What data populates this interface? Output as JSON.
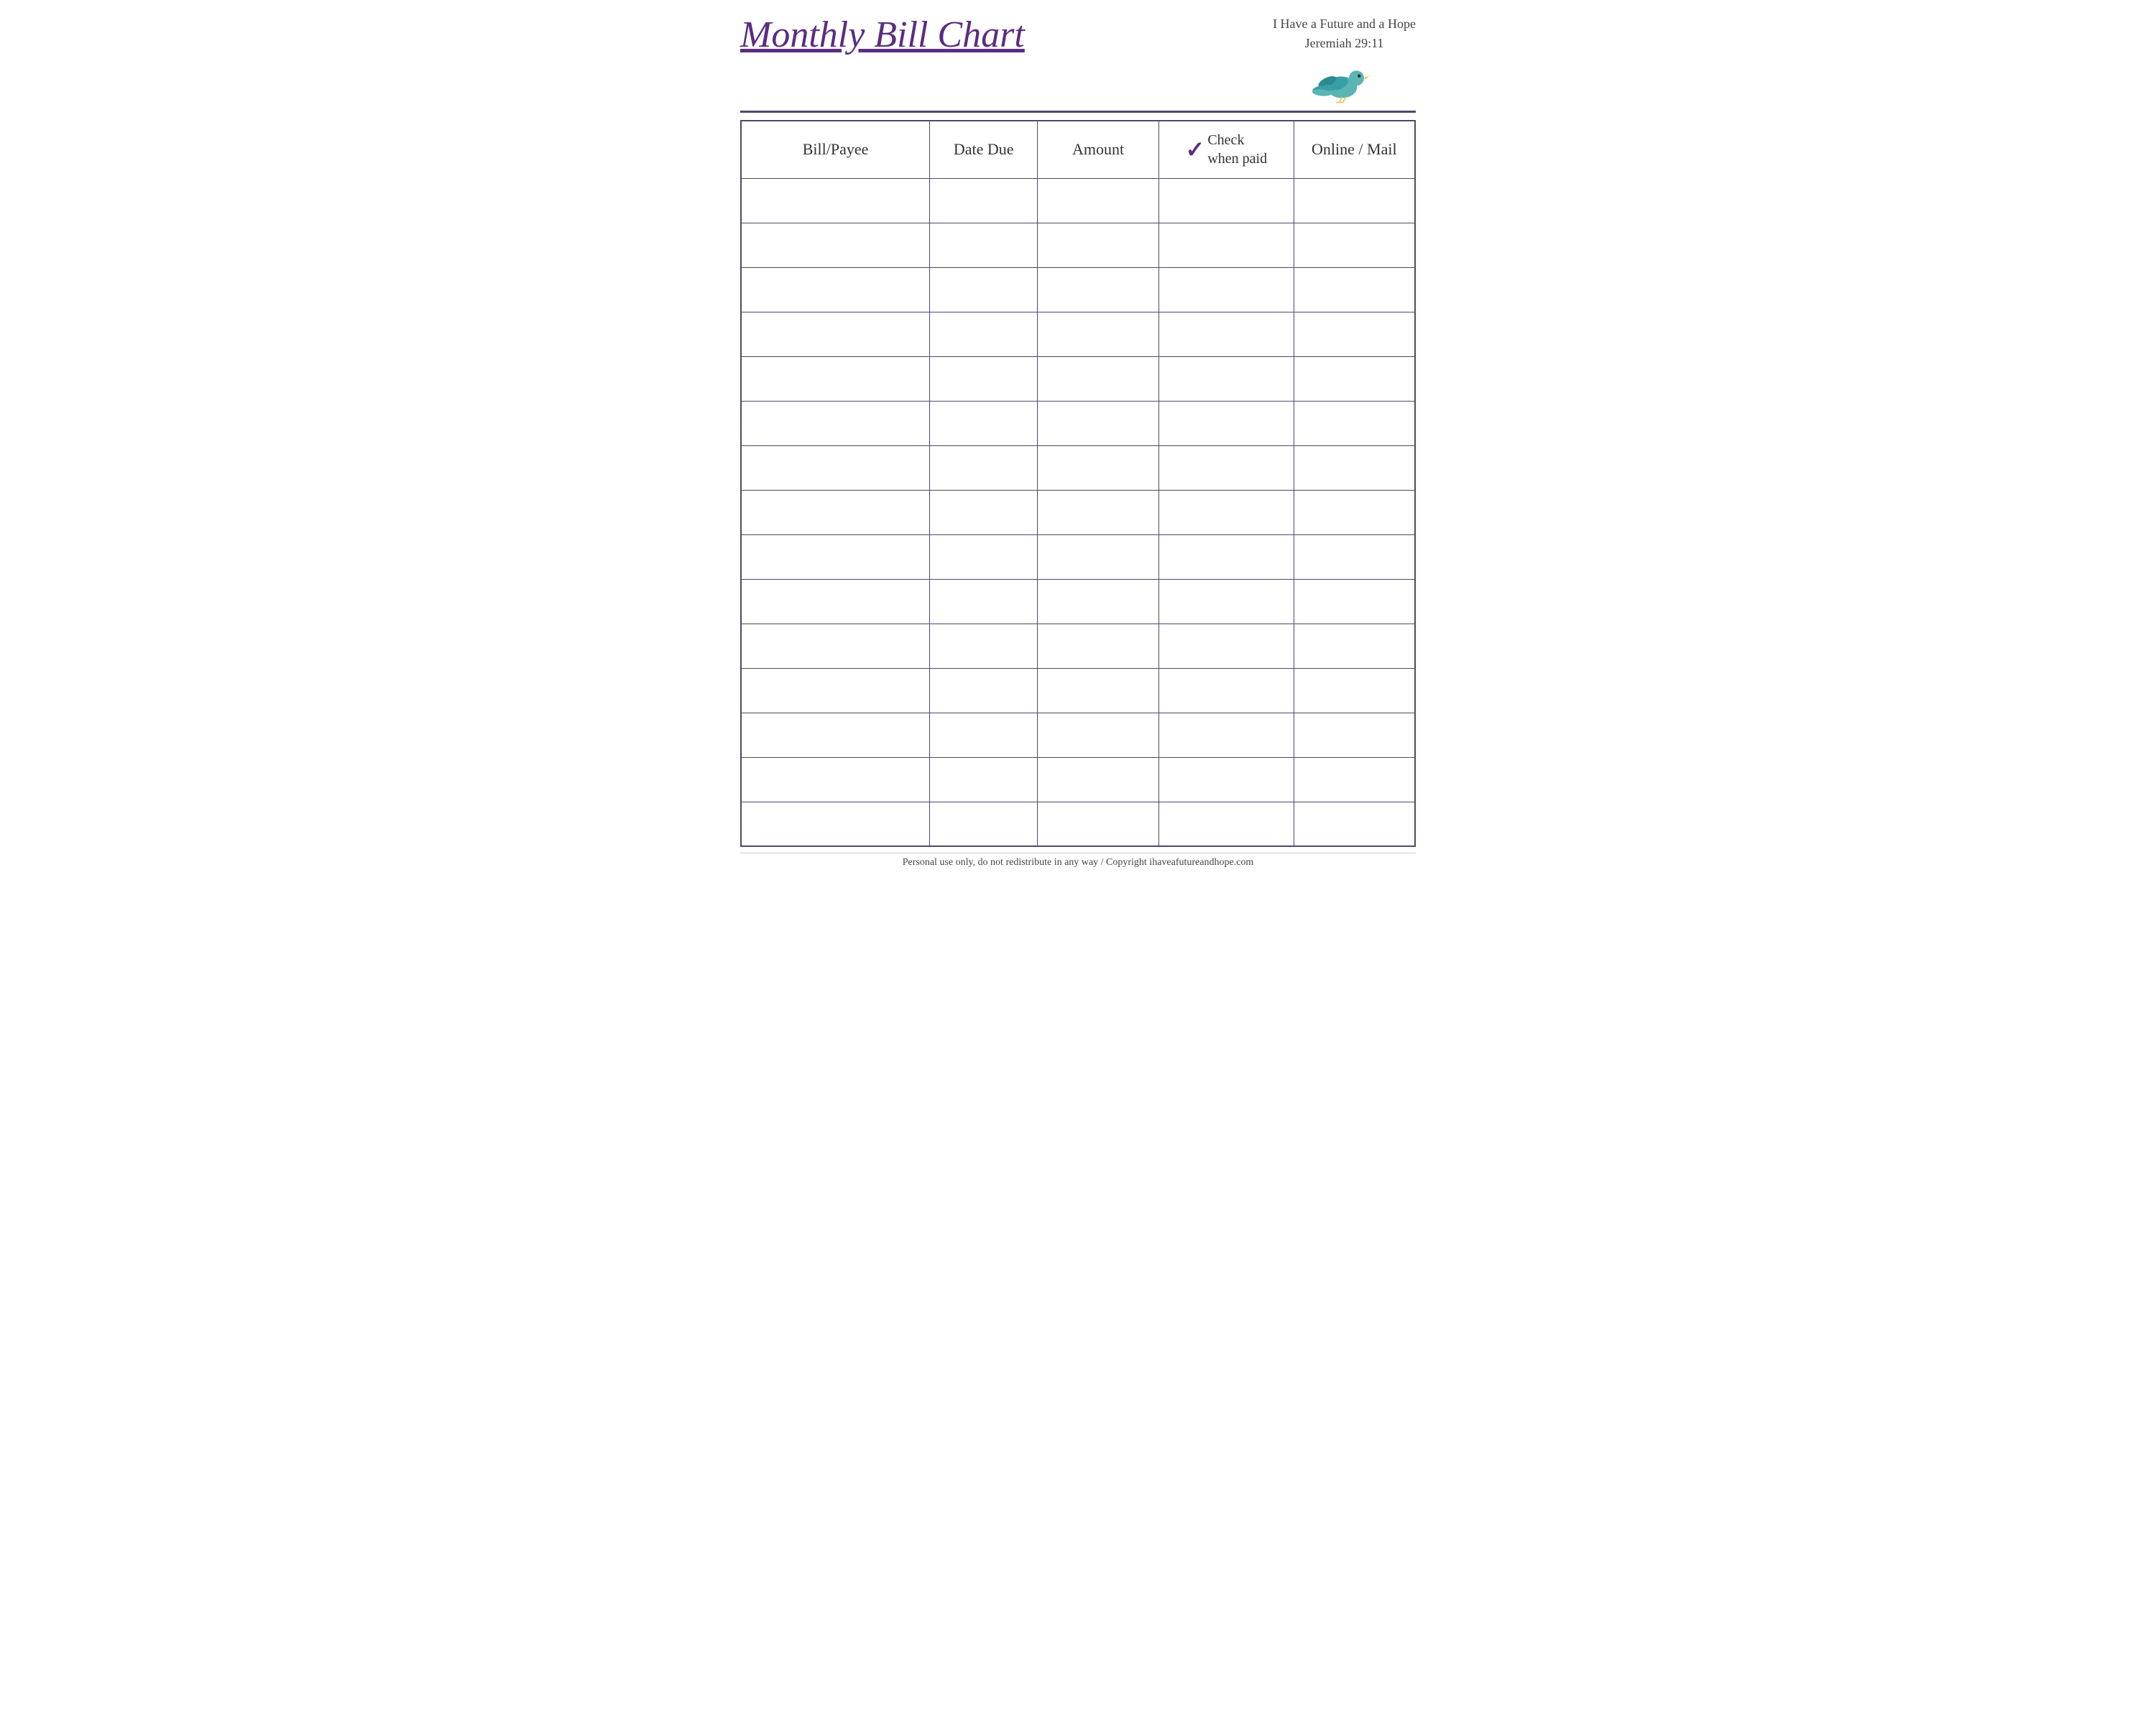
{
  "header": {
    "title": "Monthly Bill Chart",
    "tagline_line1": "I Have a Future and a Hope",
    "tagline_line2": "Jeremiah 29:11"
  },
  "table": {
    "columns": [
      {
        "key": "bill_payee",
        "label": "Bill/Payee"
      },
      {
        "key": "date_due",
        "label": "Date Due"
      },
      {
        "key": "amount",
        "label": "Amount"
      },
      {
        "key": "check_when_paid",
        "label": "Check when paid",
        "checkmark": "✓"
      },
      {
        "key": "online_mail",
        "label": "Online / Mail"
      }
    ],
    "num_rows": 15
  },
  "footer": {
    "text": "Personal use only, do not redistribute in any way / Copyright ihaveafutureandhope.com"
  }
}
